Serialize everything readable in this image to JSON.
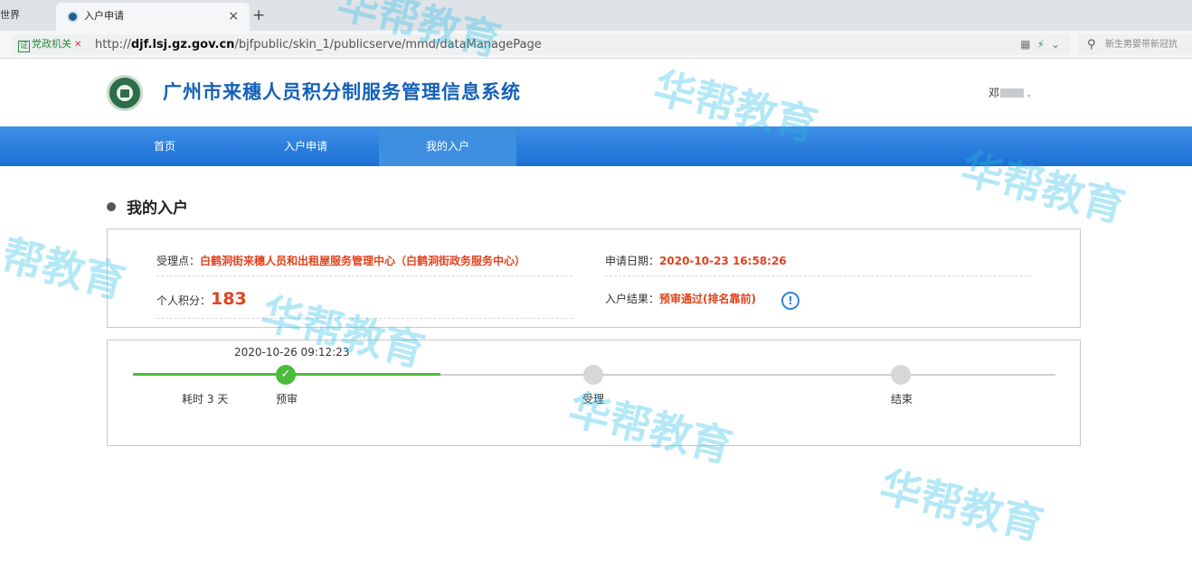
{
  "browser": {
    "prev_tab_label": "世界",
    "active_tab_title": "入户申请",
    "close_symbol": "×",
    "new_tab_symbol": "+",
    "cert_label": "党政机关",
    "cert_icon_text": "证",
    "url_prefix": "http://",
    "url_domain": "djf.lsj.gz.gov.cn",
    "url_path": "/bjfpublic/skin_1/publicserve/mmd/dataManagePage",
    "search_placeholder": "新生男婴带新冠抗"
  },
  "header": {
    "title": "广州市来穗人员积分制服务管理信息系统",
    "user_name_visible": "邓"
  },
  "nav": {
    "items": [
      {
        "label": "首页"
      },
      {
        "label": "入户申请"
      },
      {
        "label": "我的入户"
      }
    ],
    "active_index": 2
  },
  "main": {
    "section_title": "我的入户",
    "info": {
      "office_label": "受理点：",
      "office_value": "白鹤洞街来穗人员和出租屋服务管理中心（白鹤洞街政务服务中心）",
      "date_label": "申请日期：",
      "date_value": "2020-10-23 16:58:26",
      "score_label": "个人积分：",
      "score_value": "183",
      "result_label": "入户结果：",
      "result_value": "预审通过(排名靠前)",
      "result_info_icon": "!"
    },
    "progress": {
      "step_time": "2020-10-26 09:12:23",
      "duration_label": "耗时 3 天",
      "steps": [
        {
          "label": "预审",
          "status": "done",
          "mark": "✓"
        },
        {
          "label": "受理",
          "status": "pending"
        },
        {
          "label": "结束",
          "status": "pending"
        }
      ]
    }
  },
  "watermark": {
    "text": "华帮教育",
    "partial_text": "帮教育"
  },
  "colors": {
    "brand_blue": "#1561b8",
    "nav_blue": "#2a7fde",
    "accent_red": "#e0431d",
    "done_green": "#4cbb3b"
  }
}
